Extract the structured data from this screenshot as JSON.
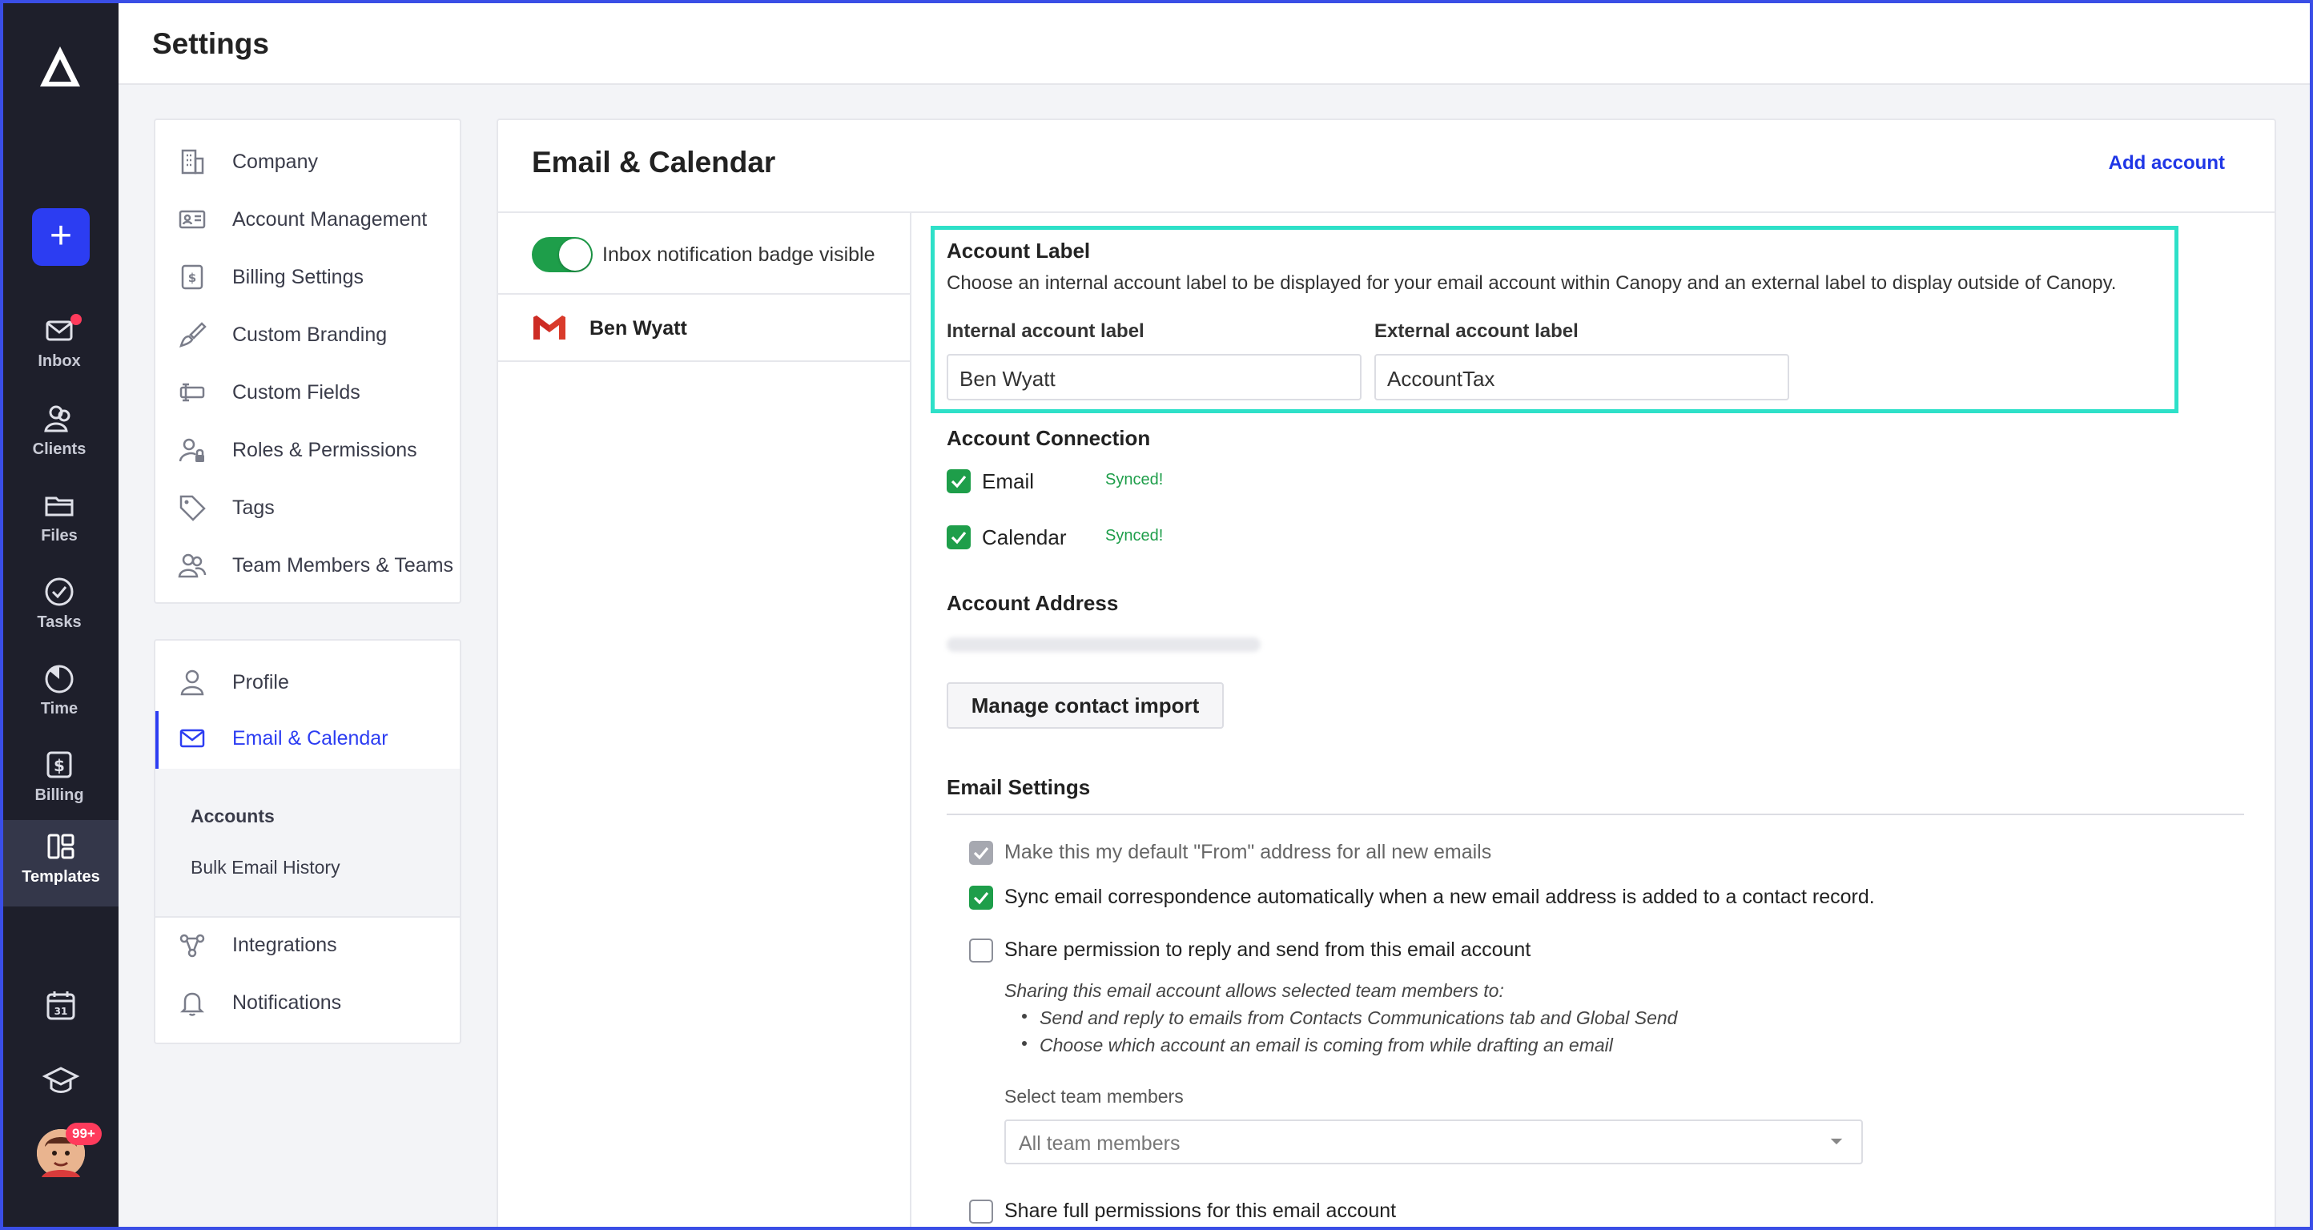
{
  "header": {
    "title": "Settings"
  },
  "rail": {
    "items": [
      {
        "label": "Inbox"
      },
      {
        "label": "Clients"
      },
      {
        "label": "Files"
      },
      {
        "label": "Tasks"
      },
      {
        "label": "Time"
      },
      {
        "label": "Billing"
      },
      {
        "label": "Templates"
      }
    ],
    "avatar_badge": "99+"
  },
  "settings_nav": {
    "group1": [
      {
        "label": "Company",
        "icon": "building-icon"
      },
      {
        "label": "Account Management",
        "icon": "id-card-icon"
      },
      {
        "label": "Billing Settings",
        "icon": "billing-icon"
      },
      {
        "label": "Custom Branding",
        "icon": "brush-icon"
      },
      {
        "label": "Custom Fields",
        "icon": "field-icon"
      },
      {
        "label": "Roles & Permissions",
        "icon": "user-lock-icon"
      },
      {
        "label": "Tags",
        "icon": "tag-icon"
      },
      {
        "label": "Team Members & Teams",
        "icon": "team-icon"
      }
    ],
    "group2": [
      {
        "label": "Profile",
        "icon": "user-icon"
      },
      {
        "label": "Email & Calendar",
        "icon": "mail-icon"
      }
    ],
    "subnav": {
      "accounts": "Accounts",
      "bulk": "Bulk Email History"
    },
    "group3": [
      {
        "label": "Integrations",
        "icon": "integrations-icon"
      },
      {
        "label": "Notifications",
        "icon": "bell-icon"
      }
    ]
  },
  "main": {
    "title": "Email & Calendar",
    "add_account": "Add account",
    "toggle_label": "Inbox notification badge visible",
    "account_name": "Ben Wyatt",
    "account_label": {
      "title": "Account Label",
      "description": "Choose an internal account label to be displayed for your email account within Canopy and an external label to display outside of Canopy.",
      "internal_label": "Internal account label",
      "internal_value": "Ben Wyatt",
      "external_label": "External account label",
      "external_value": "AccountTax"
    },
    "connection": {
      "title": "Account Connection",
      "email": "Email",
      "calendar": "Calendar",
      "synced": "Synced!"
    },
    "address": {
      "title": "Account Address",
      "manage_button": "Manage contact import"
    },
    "email_settings": {
      "title": "Email Settings",
      "default_from": "Make this my default \"From\" address for all new emails",
      "sync": "Sync email correspondence automatically when a new email address is added to a contact record.",
      "share_reply": "Share permission to reply and send from this email account",
      "sharing_intro": "Sharing this email account allows selected team members to:",
      "bullet1": "Send and reply to emails from Contacts Communications tab and Global Send",
      "bullet2": "Choose which account an email is coming from while drafting an email",
      "select_label": "Select team members",
      "select_value": "All team members",
      "share_full": "Share full permissions for this email account"
    }
  },
  "colors": {
    "accent": "#2c3df2",
    "success": "#1e9e4a",
    "highlight": "#2ee0c8",
    "rail": "#1e1f2b"
  }
}
